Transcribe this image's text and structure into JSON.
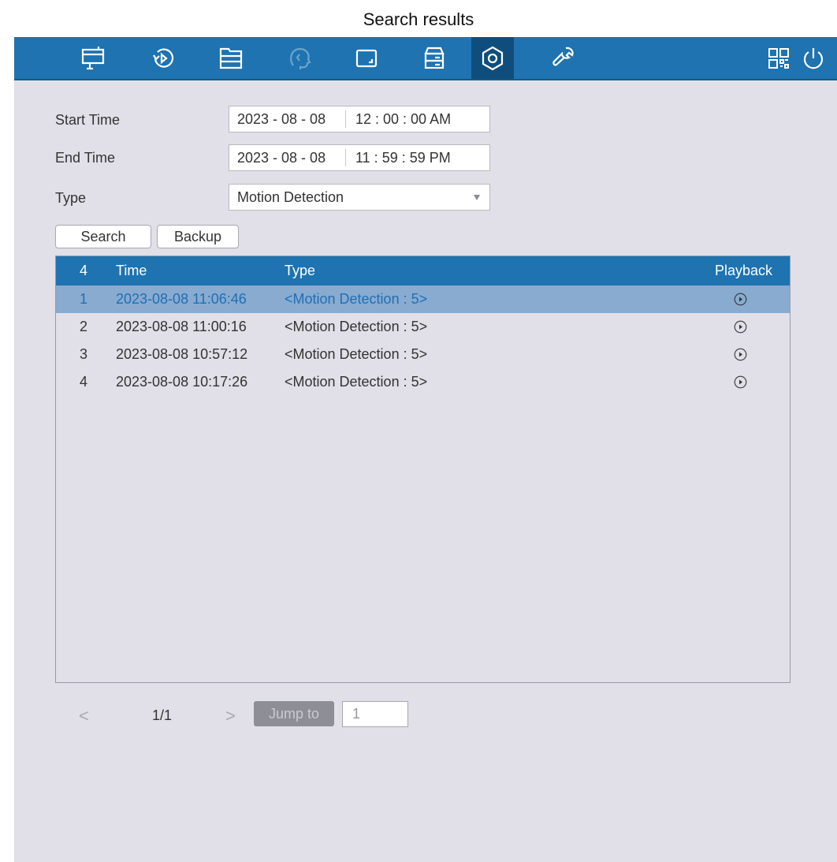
{
  "caption": "Search results",
  "nav": {
    "items": [
      {
        "name": "live-view-icon"
      },
      {
        "name": "playback-icon"
      },
      {
        "name": "file-management-icon"
      },
      {
        "name": "ai-icon"
      },
      {
        "name": "camera-icon"
      },
      {
        "name": "storage-icon"
      },
      {
        "name": "settings-icon",
        "active": true
      },
      {
        "name": "maintenance-icon"
      }
    ],
    "right": [
      {
        "name": "qr-code-icon"
      },
      {
        "name": "power-icon"
      }
    ]
  },
  "form": {
    "start_label": "Start Time",
    "start_date": "2023 - 08 - 08",
    "start_time": "12 : 00 : 00  AM",
    "end_label": "End Time",
    "end_date": "2023 - 08 - 08",
    "end_time": "11 : 59 : 59  PM",
    "type_label": "Type",
    "type_value": "Motion Detection",
    "search_label": "Search",
    "backup_label": "Backup"
  },
  "results": {
    "count": "4",
    "col_time": "Time",
    "col_type": "Type",
    "col_playback": "Playback",
    "rows": [
      {
        "idx": "1",
        "time": "2023-08-08 11:06:46",
        "type": "<Motion Detection : 5>",
        "selected": true
      },
      {
        "idx": "2",
        "time": "2023-08-08 11:00:16",
        "type": "<Motion Detection : 5>"
      },
      {
        "idx": "3",
        "time": "2023-08-08 10:57:12",
        "type": "<Motion Detection : 5>"
      },
      {
        "idx": "4",
        "time": "2023-08-08 10:17:26",
        "type": "<Motion Detection : 5>"
      }
    ]
  },
  "pager": {
    "prev": "<",
    "next": ">",
    "page_info": "1/1",
    "jump_label": "Jump to",
    "jump_value": "1"
  },
  "colors": {
    "accent": "#1e73b0",
    "background": "#e1e0e8",
    "selected_row": "#89abd0"
  }
}
